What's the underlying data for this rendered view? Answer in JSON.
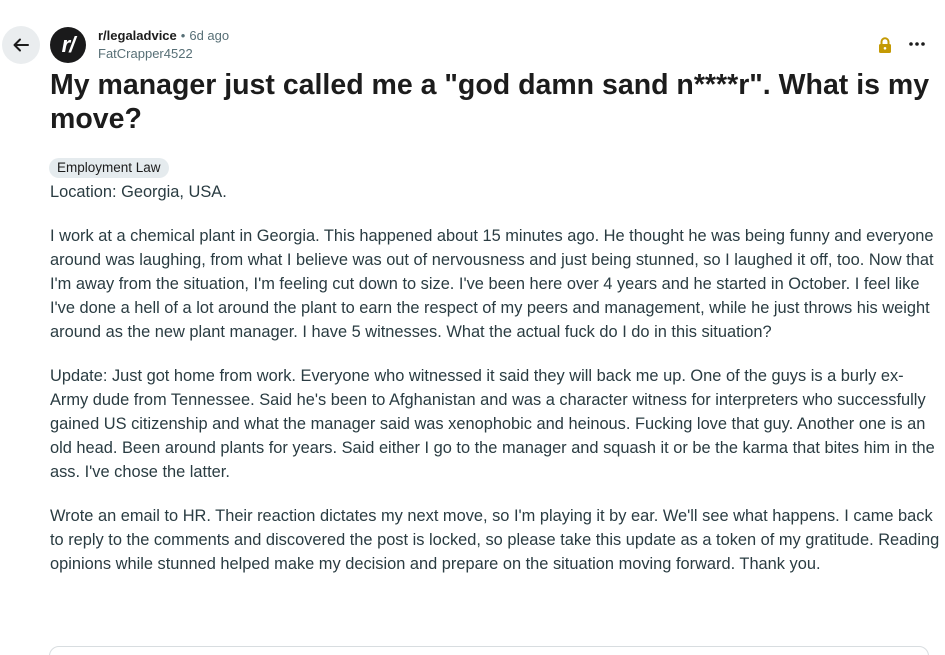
{
  "header": {
    "subreddit": "r/legaladvice",
    "separator": "•",
    "time_ago": "6d ago",
    "author": "FatCrapper4522",
    "avatar_text": "r/"
  },
  "icons": {
    "back": "arrow-left-icon",
    "lock": "lock-icon",
    "more": "more-options-icon"
  },
  "colors": {
    "lock": "#c49a04",
    "meta": "#576f76",
    "flair_bg": "#e5ebee"
  },
  "post": {
    "title": "My manager just called me a \"god damn sand n****r\". What is my move?",
    "flair": "Employment Law",
    "location": "Location: Georgia, USA.",
    "paragraphs": [
      "I work at a chemical plant in Georgia. This happened about 15 minutes ago. He thought he was being funny and everyone around was laughing, from what I believe was out of nervousness and just being stunned, so I laughed it off, too. Now that I'm away from the situation, I'm feeling cut down to size. I've been here over 4 years and he started in October. I feel like I've done a hell of a lot around the plant to earn the respect of my peers and management, while he just throws his weight around as the new plant manager. I have 5 witnesses. What the actual fuck do I do in this situation?",
      "Update: Just got home from work. Everyone who witnessed it said they will back me up. One of the guys is a burly ex-Army dude from Tennessee. Said he's been to Afghanistan and was a character witness for interpreters who successfully gained US citizenship and what the manager said was xenophobic and heinous. Fucking love that guy. Another one is an old head. Been around plants for years. Said either I go to the manager and squash it or be the karma that bites him in the ass. I've chose the latter.",
      "Wrote an email to HR. Their reaction dictates my next move, so I'm playing it by ear. We'll see what happens. I came back to reply to the comments and discovered the post is locked, so please take this update as a token of my gratitude. Reading opinions while stunned helped make my decision and prepare on the situation moving forward. Thank you."
    ]
  }
}
